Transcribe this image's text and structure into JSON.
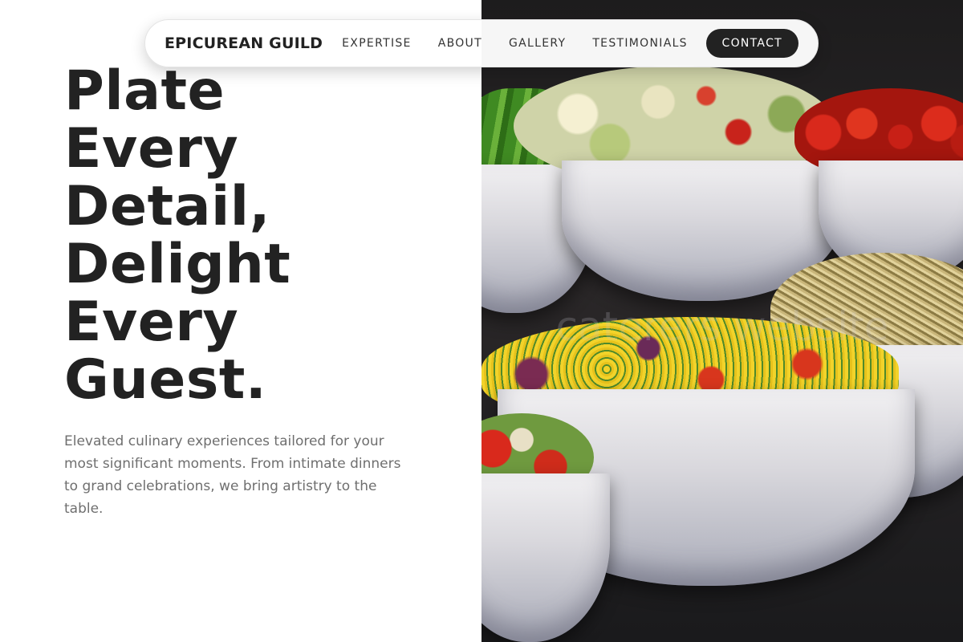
{
  "brand": {
    "name": "EPICUREAN GUILD"
  },
  "nav": {
    "links": [
      "EXPERTISE",
      "ABOUT",
      "GALLERY",
      "TESTIMONIALS"
    ],
    "cta_label": "CONTACT"
  },
  "hero": {
    "headline_lines": [
      "Plate",
      "Every",
      "Detail,",
      "Delight",
      "Every",
      "Guest."
    ],
    "lede": "Elevated culinary experiences tailored for your most significant moments. From intimate dinners to grand celebrations, we bring artistry to the table.",
    "watermark": "caterers website"
  },
  "colors": {
    "text_dark": "#222222",
    "text_muted": "#6f6f6f",
    "button_bg": "#222222",
    "button_text": "#ffffff",
    "background": "#ffffff"
  }
}
